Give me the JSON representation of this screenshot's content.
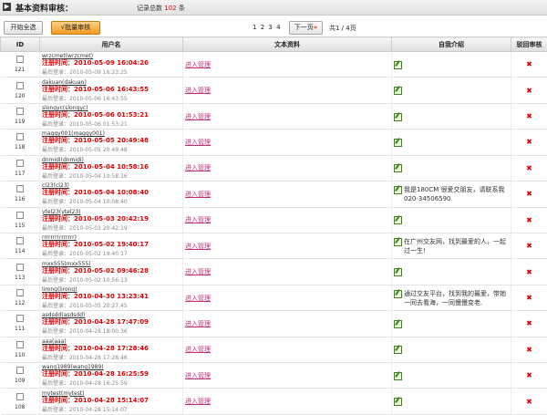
{
  "header": {
    "title": "基本资料审核：",
    "count_label": "记录总数",
    "count_value": "102",
    "count_unit": "条"
  },
  "toolbar": {
    "select_all_label": "开始全选",
    "batch_review_label": "√批量审核",
    "pages": [
      "1",
      "2",
      "3",
      "4"
    ],
    "next_label": "下一页",
    "page_info": "共1 / 4页"
  },
  "table": {
    "headers": {
      "id": "ID",
      "username": "用户名",
      "profile": "文本资料",
      "intro": "自我介绍",
      "reject": "驳回审核"
    },
    "manage_label": "进入管理",
    "rows": [
      {
        "id": "121",
        "name": "wrzcmet(wrzcmet)",
        "reg": "注册时间：2010-05-09 16:04:26",
        "last": "最后登录：2010-05-09 16:23:25",
        "intro": ""
      },
      {
        "id": "120",
        "name": "dakuan(dakuan)",
        "reg": "注册时间：2010-05-06 16:43:55",
        "last": "最后登录：2010-05-06 16:43:55",
        "intro": ""
      },
      {
        "id": "119",
        "name": "slongyc(slongyc)",
        "reg": "注册时间：2010-05-06 01:53:21",
        "last": "最后登录：2010-05-06 01:53:21",
        "intro": ""
      },
      {
        "id": "118",
        "name": "maggy001(maggy001)",
        "reg": "注册时间：2010-05-05 20:49:48",
        "last": "最后登录：2010-05-05 20:49:48",
        "intro": ""
      },
      {
        "id": "117",
        "name": "dnmidi(dnmidi)",
        "reg": "注册时间：2010-05-04 10:58:16",
        "last": "最后登录：2010-05-04 10:58:16",
        "intro": ""
      },
      {
        "id": "116",
        "name": "cl23(cl23)",
        "reg": "注册时间：2010-05-04 10:08:40",
        "last": "最后登录：2010-05-04 10:08:40",
        "intro": "我是180CM 很爱交朋友，请联系我020-34506590"
      },
      {
        "id": "115",
        "name": "ytel23(ytel23)",
        "reg": "注册时间：2010-05-03 20:42:19",
        "last": "最后登录：2010-05-03 20:42:19",
        "intro": ""
      },
      {
        "id": "114",
        "name": "rrrrrrr(rrrrrrr)",
        "reg": "注册时间：2010-05-02 19:40:17",
        "last": "最后登录：2010-05-02 19:40:17",
        "intro": "在广州交友网，找到最爱的人，一起过一生!"
      },
      {
        "id": "113",
        "name": "mxx555(mxx555)",
        "reg": "注册时间：2010-05-02 09:46:28",
        "last": "最后登录：2010-05-02 10:56:13",
        "intro": ""
      },
      {
        "id": "112",
        "name": "lirong(lirong)",
        "reg": "注册时间：2010-04-30 13:23:41",
        "last": "最后登录：2010-05-05 20:27:45",
        "intro": "通过交友平台，找到我的最爱，带她一同去看海，一同慢慢变老."
      },
      {
        "id": "111",
        "name": "asdsdd(asdsdd)",
        "reg": "注册时间：2010-04-28 17:47:09",
        "last": "最后登录：2010-04-28 18:00:36",
        "intro": ""
      },
      {
        "id": "110",
        "name": "aaa(aaa)",
        "reg": "注册时间：2010-04-28 17:28:46",
        "last": "最后登录：2010-04-28 17:28:46",
        "intro": ""
      },
      {
        "id": "109",
        "name": "wang1989(wang1989)",
        "reg": "注册时间：2010-04-28 16:25:59",
        "last": "最后登录：2010-04-28 16:25:59",
        "intro": ""
      },
      {
        "id": "108",
        "name": "mytest(mytest)",
        "reg": "注册时间：2010-04-28 15:14:07",
        "last": "最后登录：2010-04-28 15:14:07",
        "intro": ""
      }
    ]
  }
}
